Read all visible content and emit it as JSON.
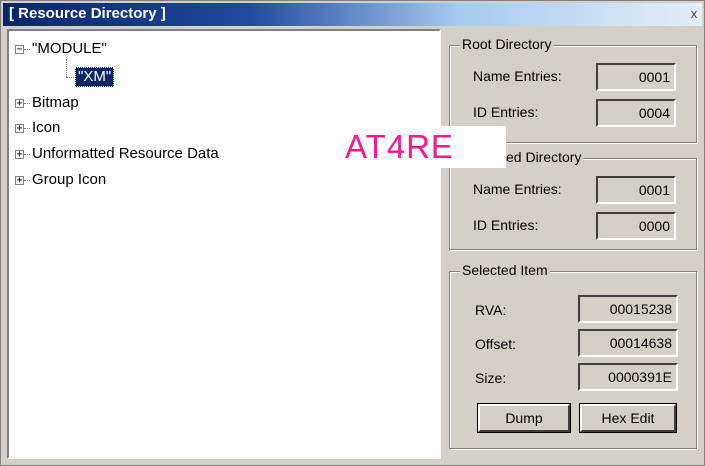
{
  "window": {
    "title": "[ Resource Directory ]",
    "close_label": "x"
  },
  "tree": {
    "root_label": "\"MODULE\"",
    "child_label": "\"XM\"",
    "items": [
      "Bitmap",
      "Icon",
      "Unformatted Resource Data",
      "Group Icon"
    ]
  },
  "watermark": "AT4RE",
  "root_directory": {
    "title": "Root Directory",
    "name_entries_label": "Name Entries:",
    "name_entries": "0001",
    "id_entries_label": "ID Entries:",
    "id_entries": "0004"
  },
  "selected_directory": {
    "title": "ed Directory",
    "name_entries_label": "Name Entries:",
    "name_entries": "0001",
    "id_entries_label": "ID Entries:",
    "id_entries": "0000"
  },
  "selected_item": {
    "title": "Selected Item",
    "rva_label": "RVA:",
    "rva": "00015238",
    "offset_label": "Offset:",
    "offset": "00014638",
    "size_label": "Size:",
    "size": "0000391E"
  },
  "buttons": {
    "dump": "Dump",
    "hex_edit": "Hex Edit"
  },
  "colors": {
    "title_start": "#0a246a",
    "selection": "#0a246a",
    "watermark": "#ff1493",
    "face": "#d4d0c8"
  }
}
